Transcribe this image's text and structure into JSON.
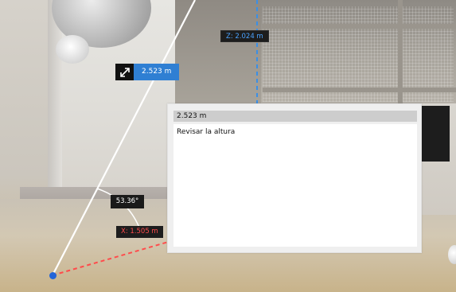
{
  "measurement": {
    "distance_label": "2.523 m",
    "z_label": "Z:  2.024 m",
    "x_label": "X:  1.505 m",
    "angle_label": "53.36°",
    "resize_icon": "diagonal-arrows-icon"
  },
  "dialog": {
    "title": "2.523 m",
    "note_text": "Revisar la altura"
  },
  "colors": {
    "z_axis": "#3a8fe6",
    "x_axis": "#ff4b4b",
    "distance_badge": "#2f7fd3",
    "endpoint": "#2265d8"
  }
}
